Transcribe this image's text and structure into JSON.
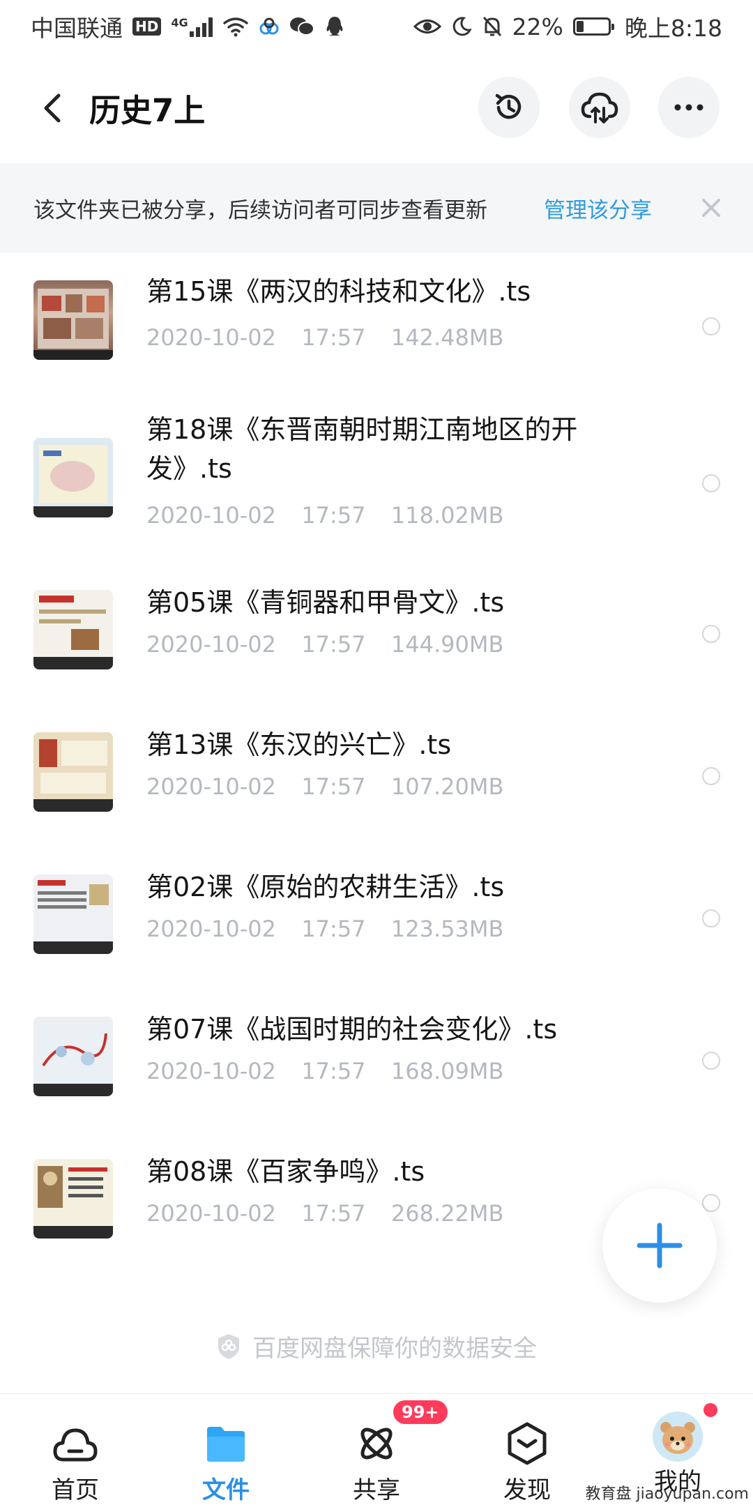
{
  "status_bar": {
    "carrier": "中国联通",
    "hd": "HD",
    "network": "4G",
    "battery": "22%",
    "battery_level": 0.22,
    "time": "晚上8:18"
  },
  "header": {
    "title": "历史7上"
  },
  "banner": {
    "text": "该文件夹已被分享，后续访问者可同步查看更新",
    "link": "管理该分享"
  },
  "files": [
    {
      "name": "第15课《两汉的科技和文化》.ts",
      "date": "2020-10-02",
      "time": "17:57",
      "size": "142.48MB"
    },
    {
      "name": "第18课《东晋南朝时期江南地区的开发》.ts",
      "date": "2020-10-02",
      "time": "17:57",
      "size": "118.02MB"
    },
    {
      "name": "第05课《青铜器和甲骨文》.ts",
      "date": "2020-10-02",
      "time": "17:57",
      "size": "144.90MB"
    },
    {
      "name": "第13课《东汉的兴亡》.ts",
      "date": "2020-10-02",
      "time": "17:57",
      "size": "107.20MB"
    },
    {
      "name": "第02课《原始的农耕生活》.ts",
      "date": "2020-10-02",
      "time": "17:57",
      "size": "123.53MB"
    },
    {
      "name": "第07课《战国时期的社会变化》.ts",
      "date": "2020-10-02",
      "time": "17:57",
      "size": "168.09MB"
    },
    {
      "name": "第08课《百家争鸣》.ts",
      "date": "2020-10-02",
      "time": "17:57",
      "size": "268.22MB"
    }
  ],
  "footer": {
    "safety_text": "百度网盘保障你的数据安全"
  },
  "nav": {
    "items": [
      {
        "label": "首页"
      },
      {
        "label": "文件"
      },
      {
        "label": "共享"
      },
      {
        "label": "发现"
      },
      {
        "label": "我的"
      }
    ],
    "share_badge": "99+"
  },
  "watermark": "教育盘 jiaoyupan.com",
  "colors": {
    "accent": "#2b8fe5",
    "link": "#2e9cde",
    "badge": "#ff3b5c",
    "meta": "#b4b8c0"
  }
}
